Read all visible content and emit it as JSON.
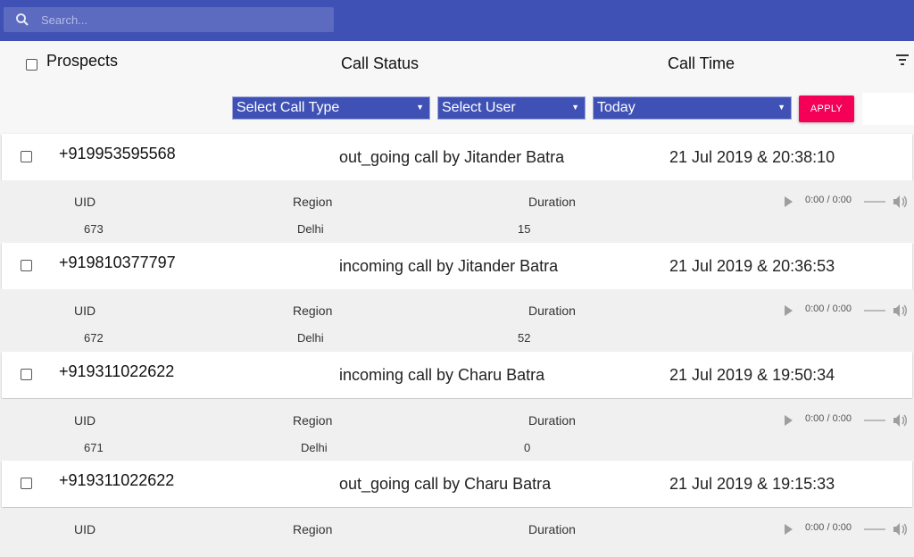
{
  "search": {
    "placeholder": "Search..."
  },
  "header": {
    "prospects": "Prospects",
    "call_status": "Call Status",
    "call_time": "Call Time"
  },
  "filters": {
    "call_type": "Select Call Type",
    "user": "Select User",
    "date": "Today",
    "apply": "APPLY"
  },
  "detail_labels": {
    "uid": "UID",
    "region": "Region",
    "duration": "Duration"
  },
  "audio": {
    "time": "0:00 / 0:00"
  },
  "calls": [
    {
      "phone": "+919953595568",
      "status": "out_going call by Jitander Batra",
      "time": "21 Jul 2019 & 20:38:10",
      "uid": "673",
      "region": "Delhi",
      "duration": "15"
    },
    {
      "phone": "+919810377797",
      "status": "incoming call by Jitander Batra",
      "time": "21 Jul 2019 & 20:36:53",
      "uid": "672",
      "region": "Delhi",
      "duration": "52"
    },
    {
      "phone": "+919311022622",
      "status": "incoming call by Charu Batra",
      "time": "21 Jul 2019 & 19:50:34",
      "uid": "671",
      "region": "Delhi",
      "duration": "0"
    },
    {
      "phone": "+919311022622",
      "status": "out_going call by Charu Batra",
      "time": "21 Jul 2019 & 19:15:33"
    }
  ],
  "colors": {
    "primary": "#3f51b5",
    "accent": "#f50057"
  },
  "icons": [
    "search-icon",
    "filter-icon",
    "play-icon",
    "volume-icon",
    "caret-down-icon"
  ]
}
